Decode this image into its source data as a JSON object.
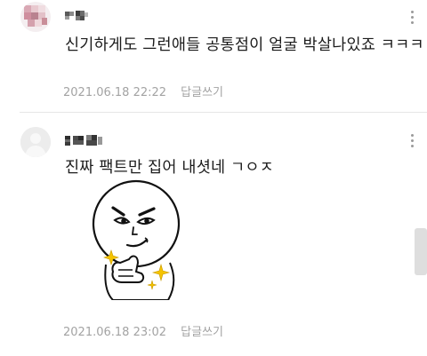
{
  "comments": [
    {
      "text": "신기하게도 그런애들 공통점이 얼굴 박살나있죠 ㅋㅋㅋ",
      "date": "2021.06.18 22:22",
      "reply_label": "답글쓰기"
    },
    {
      "text": "진짜 팩트만 집어 내셧네 ㄱㅇㅈ",
      "date": "2021.06.18 23:02",
      "reply_label": "답글쓰기"
    }
  ],
  "icons": {
    "more": "vertical-ellipsis-icon",
    "avatar_default": "default-avatar-icon",
    "sticker": "smirk-thumbs-up-sticker"
  },
  "colors": {
    "text": "#1c1c1c",
    "meta": "#a3a3a3",
    "divider": "#e6e6e6",
    "sparkle": "#f5c400"
  }
}
